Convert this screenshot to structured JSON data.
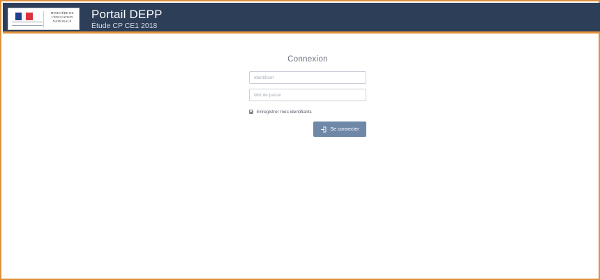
{
  "header": {
    "logo": {
      "ministry_text": "MINISTÈRE DE L'ÉDUCATION NATIONALE"
    },
    "title": "Portail DEPP",
    "subtitle": "Étude CP CE1 2018"
  },
  "login": {
    "title": "Connexion",
    "username_placeholder": "Identifiant",
    "password_placeholder": "Mot de passe",
    "remember_label": "Enregistrer mes identifiants",
    "remember_checked": true,
    "submit_label": "Se connecter",
    "submit_icon": "sign-in-icon"
  },
  "colors": {
    "header_bg": "#2d3e58",
    "accent_border": "#e0913a",
    "button_bg": "#6f88a8"
  }
}
